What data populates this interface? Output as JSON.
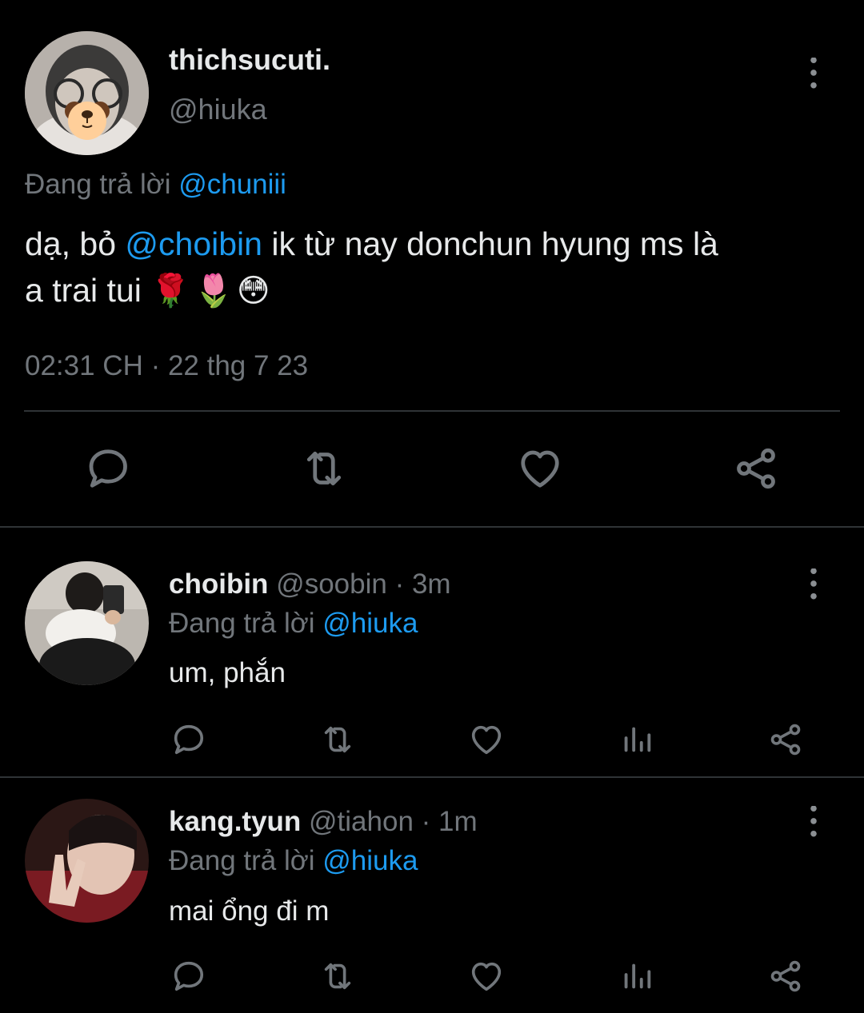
{
  "main_tweet": {
    "display_name": "thichsucuti.",
    "handle": "@hiuka",
    "replying_prefix": "Đang trả lời",
    "replying_to": "@chuniii",
    "text_before": "dạ, bỏ",
    "mention": "@choibin",
    "text_line1_after": "ik từ nay donchun hyung ms là",
    "text_line2": "a trai tui",
    "emojis": "🌹🌷😳",
    "timestamp": "02:31 CH · 22 thg 7 23",
    "actions": [
      "reply-icon",
      "retweet-icon",
      "like-icon",
      "share-icon"
    ]
  },
  "replies": [
    {
      "display_name": "choibin",
      "handle": "@soobin",
      "time": "· 3m",
      "replying_prefix": "Đang trả lời",
      "replying_to": "@hiuka",
      "text": "um, phắn",
      "actions": [
        "reply-icon",
        "retweet-icon",
        "like-icon",
        "analytics-icon",
        "share-icon"
      ]
    },
    {
      "display_name": "kang.tyun",
      "handle": "@tiahon",
      "time": "· 1m",
      "replying_prefix": "Đang trả lời",
      "replying_to": "@hiuka",
      "text": "mai ổng đi m",
      "actions": [
        "reply-icon",
        "retweet-icon",
        "like-icon",
        "analytics-icon",
        "share-icon"
      ]
    }
  ],
  "colors": {
    "background": "#000000",
    "text": "#e7e9ea",
    "muted": "#71767b",
    "link": "#1d9bf0",
    "divider": "#2f3336"
  }
}
